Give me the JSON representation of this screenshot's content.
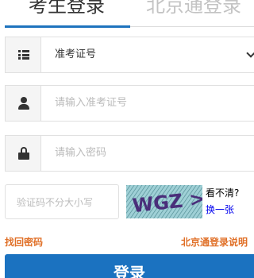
{
  "tabs": [
    {
      "label": "考生登录",
      "active": true
    },
    {
      "label": "北京通登录",
      "active": false
    }
  ],
  "form": {
    "id_type": {
      "value": "准考证号",
      "icon": "list-icon"
    },
    "id_number": {
      "placeholder": "请输入准考证号",
      "icon": "user-icon"
    },
    "password": {
      "placeholder": "请输入密码",
      "icon": "lock-icon"
    },
    "captcha": {
      "placeholder": "验证码不分大小写",
      "image_text": "WGZ >",
      "cant_see_label": "看不清?",
      "refresh_label": "换一张"
    }
  },
  "links": {
    "forgot_password": "找回密码",
    "beijingtong_help": "北京通登录说明"
  },
  "login_button": "登录",
  "colors": {
    "accent": "#1b72c0",
    "link_orange": "#e07028",
    "placeholder": "#bbbbbb"
  }
}
